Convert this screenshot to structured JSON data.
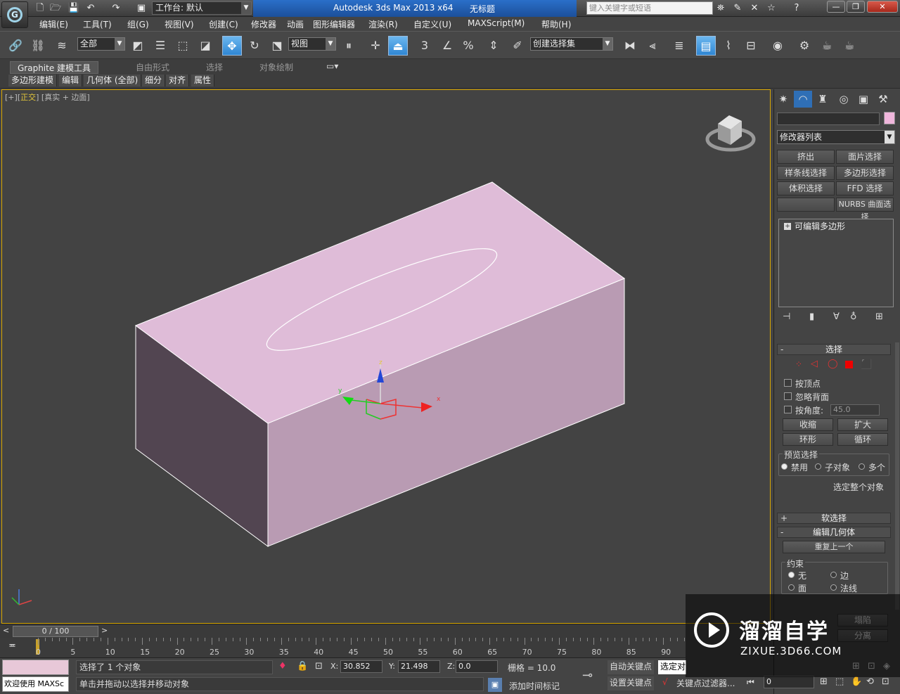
{
  "window": {
    "app_title": "Autodesk 3ds Max  2013 x64",
    "doc_title": "无标题",
    "workspace_label": "工作台: 默认",
    "search_placeholder": "键入关键字或短语"
  },
  "menu": [
    "编辑(E)",
    "工具(T)",
    "组(G)",
    "视图(V)",
    "创建(C)",
    "修改器",
    "动画",
    "图形编辑器",
    "渲染(R)",
    "自定义(U)",
    "MAXScript(M)",
    "帮助(H)"
  ],
  "toolbar": {
    "selection_filter": "全部",
    "ref_coord": "视图",
    "named_selection": "创建选择集",
    "snap_3": "3",
    "snap_percent": "%"
  },
  "ribbon": {
    "tabs": [
      "Graphite 建模工具",
      "自由形式",
      "选择",
      "对象绘制"
    ],
    "subtabs": [
      "多边形建模",
      "编辑",
      "几何体 (全部)",
      "细分",
      "对齐",
      "属性"
    ]
  },
  "viewport": {
    "label_plus": "[+]",
    "label_view": "正交",
    "label_mode": "[真实 + 边面]",
    "gizmo": {
      "x": "x",
      "y": "y",
      "z": "z"
    }
  },
  "command_panel": {
    "modifier_list": "修改器列表",
    "modifier_buttons": [
      "挤出",
      "面片选择",
      "样条线选择",
      "多边形选择",
      "体积选择",
      "FFD 选择",
      "",
      "NURBS 曲面选择"
    ],
    "stack_item": "可编辑多边形",
    "selection": {
      "header": "选择",
      "by_vertex": "按顶点",
      "ignore_backfacing": "忽略背面",
      "by_angle": "按角度:",
      "angle_value": "45.0",
      "shrink": "收缩",
      "grow": "扩大",
      "ring": "环形",
      "loop": "循环",
      "preview_label": "预览选择",
      "preview_options": [
        "禁用",
        "子对象",
        "多个"
      ],
      "select_whole": "选定整个对象"
    },
    "soft_selection": "软选择",
    "edit_geometry": "编辑几何体",
    "repeat_last": "重复上一个",
    "constraints": {
      "label": "约束",
      "options": [
        "无",
        "边",
        "面",
        "法线"
      ]
    },
    "extra_buttons": [
      "塌陷",
      "分离"
    ]
  },
  "timeline": {
    "slider_label": "0 / 100",
    "ticks": [
      "0",
      "5",
      "10",
      "15",
      "20",
      "25",
      "30",
      "35",
      "40",
      "45",
      "50",
      "55",
      "60",
      "65",
      "70",
      "75",
      "80",
      "85",
      "90"
    ]
  },
  "status": {
    "welcome": "欢迎使用 MAXSc",
    "selected": "选择了 1 个对象",
    "prompt": "单击并拖动以选择并移动对象",
    "x_label": "X:",
    "x": "30.852",
    "y_label": "Y:",
    "y": "21.498",
    "z_label": "Z:",
    "z": "0.0",
    "grid": "栅格 = 10.0",
    "auto_key": "自动关键点",
    "selected_obj": "选定对",
    "set_key": "设置关键点",
    "key_filters": "关键点过滤器...",
    "add_time_tag": "添加时间标记",
    "frame": "0"
  },
  "watermark": {
    "name": "溜溜自学",
    "url": "ZIXUE.3D66.COM"
  },
  "colors": {
    "object_top": "#dfbcd8",
    "object_front": "#b99bb3",
    "object_side": "#524551",
    "viewport_bg": "#434343",
    "active_border": "#d9a700"
  }
}
